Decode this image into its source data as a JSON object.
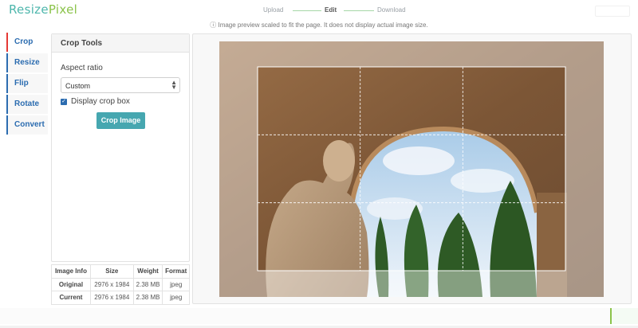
{
  "app": {
    "logo_part1": "Resize",
    "logo_part2": "Pixel"
  },
  "steps": [
    {
      "label": "Upload",
      "active": false
    },
    {
      "label": "Edit",
      "active": true
    },
    {
      "label": "Download",
      "active": false
    }
  ],
  "notice": "ⓘ Image preview scaled to fit the page. It does not display actual image size.",
  "tabs": [
    {
      "label": "Crop",
      "active": true
    },
    {
      "label": "Resize",
      "active": false
    },
    {
      "label": "Flip",
      "active": false
    },
    {
      "label": "Rotate",
      "active": false
    },
    {
      "label": "Convert",
      "active": false
    }
  ],
  "crop_tools": {
    "title": "Crop Tools",
    "aspect_label": "Aspect ratio",
    "aspect_value": "Custom",
    "display_crop_box_label": "Display crop box",
    "display_crop_box_checked": true,
    "crop_button": "Crop Image"
  },
  "image_info": {
    "headers": [
      "Image Info",
      "Size",
      "Weight",
      "Format"
    ],
    "rows": [
      {
        "label": "Original",
        "size": "2976 x 1984",
        "weight": "2.38 MB",
        "format": "jpeg"
      },
      {
        "label": "Current",
        "size": "2976 x 1984",
        "weight": "2.38 MB",
        "format": "jpeg"
      }
    ]
  },
  "colors": {
    "accent": "#46a7b0",
    "tab_text": "#2b6cb0",
    "active_tab_border": "#e53935",
    "logo_teal": "#4db6ac",
    "logo_green": "#8bc34a"
  }
}
